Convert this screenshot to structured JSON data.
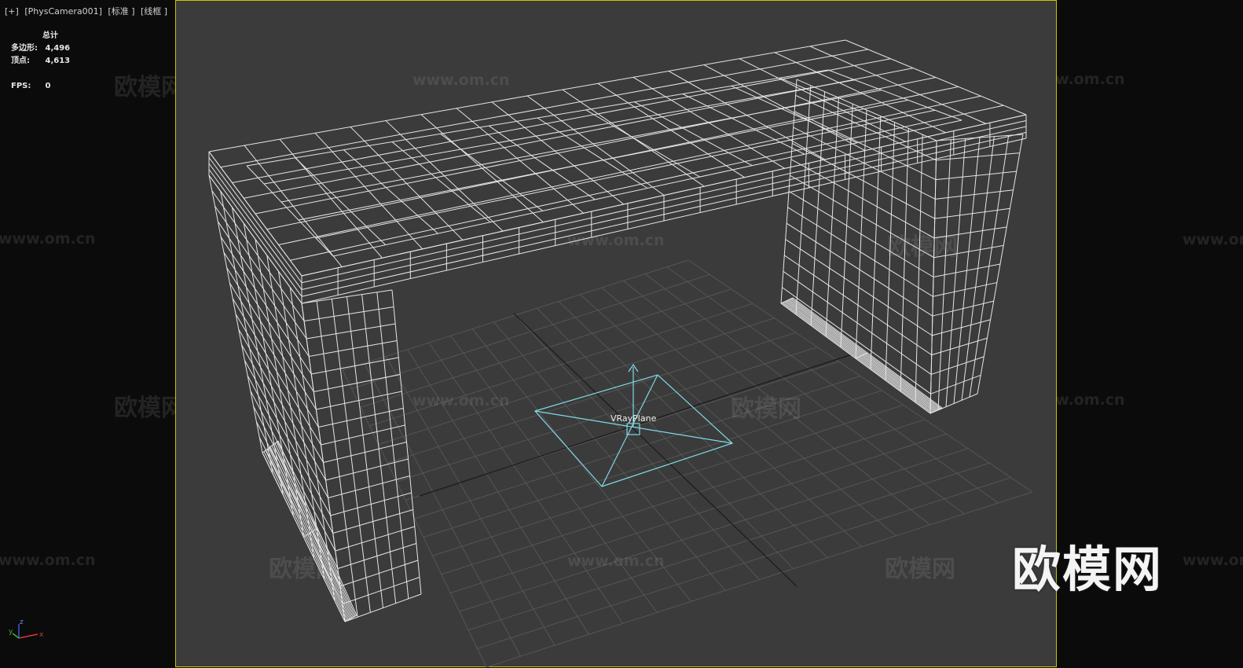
{
  "viewport": {
    "plus": "[+]",
    "camera": "[PhysCamera001]",
    "shading": "[标准 ]",
    "mode": "[线框 ]"
  },
  "stats": {
    "header": "总计",
    "polys_label": "多边形:",
    "polys_value": "4,496",
    "verts_label": "顶点:",
    "verts_value": "4,613",
    "fps_label": "FPS:",
    "fps_value": "0"
  },
  "scene": {
    "object_label": "VRayPlane",
    "wireframe_color": "#e8e8e8",
    "light_color": "#7fd9e6",
    "grid_color": "#555555",
    "border_color": "#c8c800"
  },
  "watermarks": {
    "brand_cn": "欧模网",
    "url": "www.om.cn"
  },
  "axis": {
    "x": "x",
    "y": "y",
    "z": "z"
  }
}
